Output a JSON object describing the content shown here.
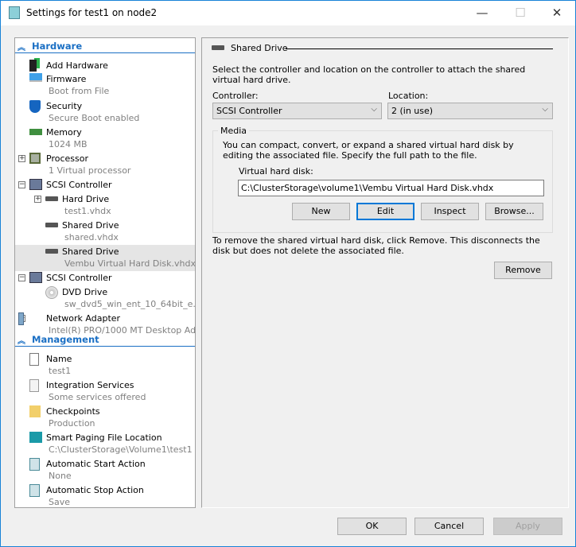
{
  "window": {
    "title": "Settings for test1 on node2",
    "minimize": "—",
    "maximize": "☐",
    "close": "✕"
  },
  "sidebar": {
    "sections": [
      {
        "title": "Hardware",
        "items": [
          {
            "title": "Add Hardware",
            "sub": null,
            "icon": "add-hardware",
            "indent": 0,
            "expander": null
          },
          {
            "title": "Firmware",
            "sub": "Boot from File",
            "icon": "firmware",
            "indent": 0,
            "expander": null
          },
          {
            "title": "Security",
            "sub": "Secure Boot enabled",
            "icon": "shield",
            "indent": 0,
            "expander": null
          },
          {
            "title": "Memory",
            "sub": "1024 MB",
            "icon": "memory",
            "indent": 0,
            "expander": null
          },
          {
            "title": "Processor",
            "sub": "1 Virtual processor",
            "icon": "processor",
            "indent": 0,
            "expander": "+"
          },
          {
            "title": "SCSI Controller",
            "sub": null,
            "icon": "scsi-controller",
            "indent": 0,
            "expander": "−"
          },
          {
            "title": "Hard Drive",
            "sub": "test1.vhdx",
            "icon": "hard-drive",
            "indent": 1,
            "expander": "+"
          },
          {
            "title": "Shared Drive",
            "sub": "shared.vhdx",
            "icon": "hard-drive",
            "indent": 1,
            "expander": null
          },
          {
            "title": "Shared Drive",
            "sub": "Vembu Virtual Hard Disk.vhdx",
            "icon": "hard-drive",
            "indent": 1,
            "expander": null,
            "selected": true
          },
          {
            "title": "SCSI Controller",
            "sub": null,
            "icon": "scsi-controller",
            "indent": 0,
            "expander": "−"
          },
          {
            "title": "DVD Drive",
            "sub": "sw_dvd5_win_ent_10_64bit_e...",
            "icon": "dvd",
            "indent": 1,
            "expander": null
          },
          {
            "title": "Network Adapter",
            "sub": "Intel(R) PRO/1000 MT Desktop Ad...",
            "icon": "network-adapter",
            "indent": 0,
            "expander": "+"
          }
        ]
      },
      {
        "title": "Management",
        "items": [
          {
            "title": "Name",
            "sub": "test1",
            "icon": "name",
            "indent": 0,
            "expander": null
          },
          {
            "title": "Integration Services",
            "sub": "Some services offered",
            "icon": "integration-services",
            "indent": 0,
            "expander": null
          },
          {
            "title": "Checkpoints",
            "sub": "Production",
            "icon": "checkpoints",
            "indent": 0,
            "expander": null
          },
          {
            "title": "Smart Paging File Location",
            "sub": "C:\\ClusterStorage\\Volume1\\test1",
            "icon": "smart-paging",
            "indent": 0,
            "expander": null
          },
          {
            "title": "Automatic Start Action",
            "sub": "None",
            "icon": "auto-start",
            "indent": 0,
            "expander": null
          },
          {
            "title": "Automatic Stop Action",
            "sub": "Save",
            "icon": "auto-stop",
            "indent": 0,
            "expander": null
          }
        ]
      }
    ]
  },
  "panel": {
    "heading": "Shared Drive",
    "intro": "Select the controller and location on the controller to attach the shared virtual hard drive.",
    "controller_label": "Controller:",
    "controller_value": "SCSI Controller",
    "location_label": "Location:",
    "location_value": "2 (in use)",
    "media": {
      "title": "Media",
      "desc": "You can compact, convert, or expand a shared virtual hard disk by editing the associated file. Specify the full path to the file.",
      "vhd_label": "Virtual hard disk:",
      "vhd_value": "C:\\ClusterStorage\\volume1\\Vembu Virtual Hard Disk.vhdx",
      "new": "New",
      "edit": "Edit",
      "inspect": "Inspect",
      "browse": "Browse..."
    },
    "remove_text": "To remove the shared virtual hard disk, click Remove. This disconnects the disk but does not delete the associated file.",
    "remove": "Remove"
  },
  "footer": {
    "ok": "OK",
    "cancel": "Cancel",
    "apply": "Apply"
  },
  "colors": {
    "accent": "#1a6fc4",
    "focus": "#0078d7",
    "selected_row": "#e5e5e5"
  }
}
